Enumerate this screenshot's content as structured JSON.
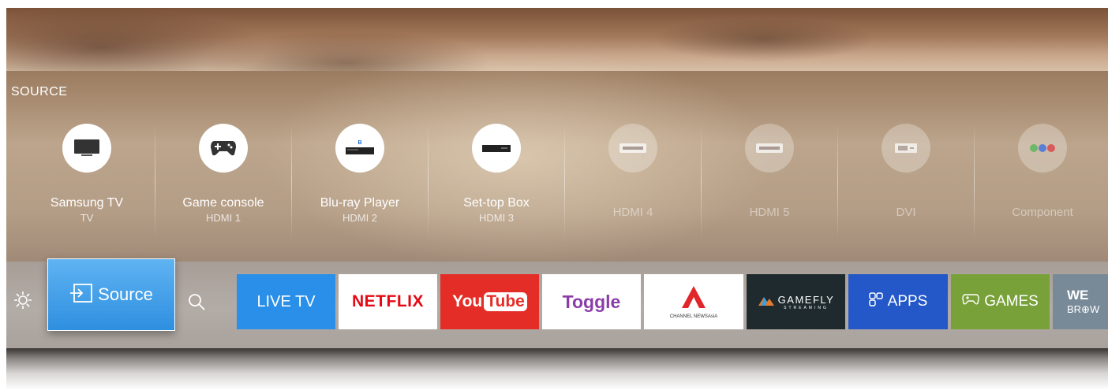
{
  "source_panel": {
    "title": "SOURCE",
    "items": [
      {
        "name": "Samsung TV",
        "sub": "TV",
        "icon": "tv-icon",
        "active": true
      },
      {
        "name": "Game console",
        "sub": "HDMI 1",
        "icon": "gamepad-icon",
        "active": true
      },
      {
        "name": "Blu-ray Player",
        "sub": "HDMI 2",
        "icon": "bluray-player-icon",
        "active": true
      },
      {
        "name": "Set-top Box",
        "sub": "HDMI 3",
        "icon": "settop-box-icon",
        "active": true
      },
      {
        "name": "HDMI 4",
        "sub": "",
        "icon": "hdmi-port-icon",
        "active": false
      },
      {
        "name": "HDMI 5",
        "sub": "",
        "icon": "hdmi-port-icon",
        "active": false
      },
      {
        "name": "DVI",
        "sub": "",
        "icon": "dvi-port-icon",
        "active": false
      },
      {
        "name": "Component",
        "sub": "",
        "icon": "component-port-icon",
        "active": false
      }
    ]
  },
  "launcher": {
    "settings_icon": "gear-icon",
    "source_button": {
      "label": "Source",
      "icon": "source-input-icon"
    },
    "search_icon": "search-icon",
    "apps": [
      {
        "label": "LIVE TV",
        "color": "#2a8fe8"
      },
      {
        "label": "NETFLIX",
        "color": "#e50914"
      },
      {
        "label_you": "You",
        "label_tube": "Tube",
        "color": "#e52d27"
      },
      {
        "label": "Toggle",
        "color": "#8a3da8"
      },
      {
        "label": "CHANNEL NEWSAsiA",
        "color": "#e0262b"
      },
      {
        "label": "GAMEFLY",
        "sub": "STREAMING",
        "color": "#1e2a2e"
      },
      {
        "label": "APPS",
        "color": "#2458c8"
      },
      {
        "label": "GAMES",
        "color": "#79a13a"
      },
      {
        "label_top": "WE",
        "label_bottom": "BR⊕W",
        "color": "#788a98"
      }
    ]
  }
}
